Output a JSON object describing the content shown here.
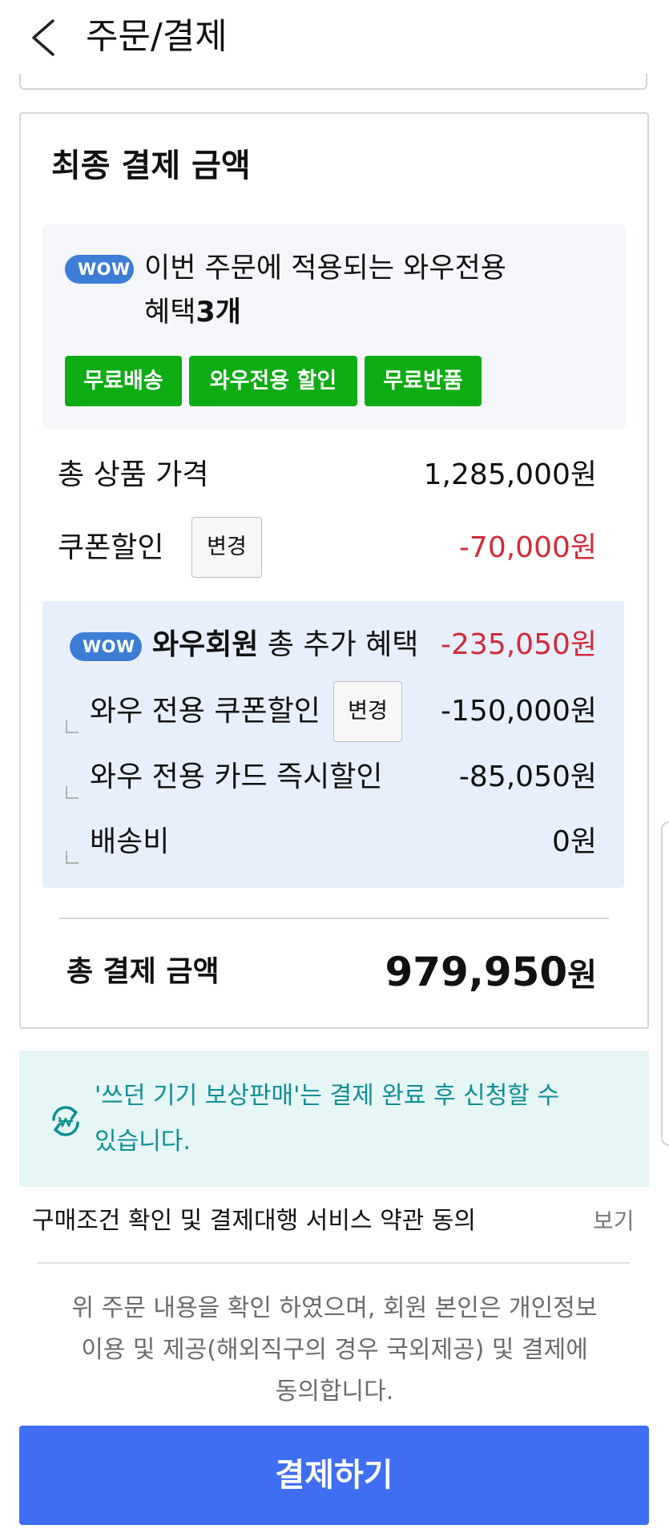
{
  "header": {
    "title": "주문/결제"
  },
  "summary": {
    "title": "최종 결제 금액",
    "wow_badge": "WOW",
    "benefit_line1": "이번 주문에 적용되는 와우전용",
    "benefit_line2_prefix": "혜택",
    "benefit_count": "3개",
    "benefit_tags": [
      "무료배송",
      "와우전용 할인",
      "무료반품"
    ],
    "total_products_label": "총 상품 가격",
    "total_products_value": "1,285,000원",
    "coupon_label": "쿠폰할인",
    "coupon_change": "변경",
    "coupon_value": "-70,000원",
    "wow_member": {
      "badge": "WOW",
      "title_bold": "와우회원",
      "title_rest": " 총 추가 혜택",
      "value": "-235,050원",
      "coupon_label": "와우 전용 쿠폰할인",
      "coupon_change": "변경",
      "coupon_value": "-150,000원",
      "card_label": "와우 전용 카드 즉시할인",
      "card_value": "-85,050원",
      "shipping_label": "배송비",
      "shipping_value": "0원"
    },
    "grand_total_label": "총 결제 금액",
    "grand_total_number": "979,950",
    "grand_total_unit": "원"
  },
  "notice": {
    "line1": "'쓰던 기기 보상판매'는 결제 완료 후 신청할 수",
    "line2": "있습니다.",
    "icon": "refresh-won-icon"
  },
  "terms": {
    "label": "구매조건 확인 및 결제대행 서비스 약관 동의",
    "view": "보기"
  },
  "agreement": {
    "line1": "위 주문 내용을 확인 하였으며, 회원 본인은 개인정보",
    "line2": "이용 및 제공(해외직구의 경우 국외제공) 및 결제에",
    "line3": "동의합니다."
  },
  "pay_button": "결제하기",
  "colors": {
    "wow_blue": "#3d7dd6",
    "tag_green": "#0dac12",
    "discount_red": "#d22b3a",
    "wow_box_bg": "#e8effc",
    "notice_teal": "#0f8f96",
    "pay_blue": "#3f6ef3"
  }
}
